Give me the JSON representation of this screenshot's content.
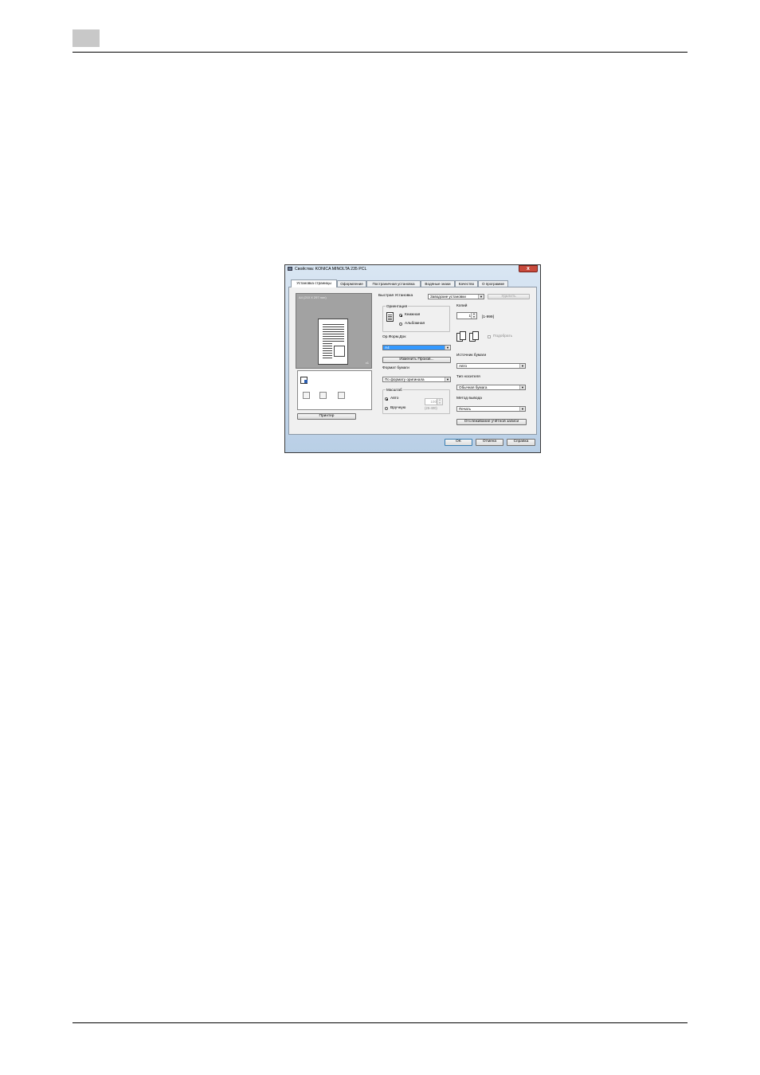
{
  "dialog": {
    "title": "Свойства: KONICA MINOLTA 235 PCL",
    "close_label": "x",
    "tabs": [
      {
        "label": "Установка страницы",
        "active": true
      },
      {
        "label": "Оформление"
      },
      {
        "label": "Пострaничная установка"
      },
      {
        "label": "Водяные знаки"
      },
      {
        "label": "Качество"
      },
      {
        "label": "О программе"
      }
    ],
    "preview": {
      "caption": "A4  (210 X 297 mm)",
      "count": "x1"
    },
    "printer_button": "Принтер",
    "quick_setup": {
      "label": "Быстрая Установка",
      "value": "Заводские установки",
      "delete_button": "Удалить"
    },
    "orientation": {
      "title": "Ориентация",
      "portrait": "Книжная",
      "landscape": "Альбомная",
      "selected": "portrait"
    },
    "original_size": {
      "label": "Ор.Форм.Док",
      "value": "A4",
      "change_button": "Изменить Произв..."
    },
    "paper_size": {
      "label": "Формат бумаги",
      "value": "По формату оригинала"
    },
    "zoom": {
      "title": "Масштаб",
      "auto": "Авто",
      "manual": "Вручную",
      "value": "100",
      "range": "(25-400)",
      "selected": "auto"
    },
    "copies": {
      "label": "Копий",
      "value": "1",
      "range": "[1-999]",
      "collate_label": "Подобрать"
    },
    "paper_source": {
      "label": "Источник бумаги",
      "value": "Авто"
    },
    "paper_type": {
      "label": "Тип носителя",
      "value": "Обычная бумага"
    },
    "output_method": {
      "label": "Метод вывода",
      "value": "Печать"
    },
    "account_track_button": "Отслеживание учётной записи",
    "ok_button": "OK",
    "cancel_button": "Отмена",
    "help_button": "Справка"
  },
  "colors": {
    "title_close": "#c84a3c",
    "selection": "#3399ff",
    "dialog_frame": "#b9cfe6"
  }
}
